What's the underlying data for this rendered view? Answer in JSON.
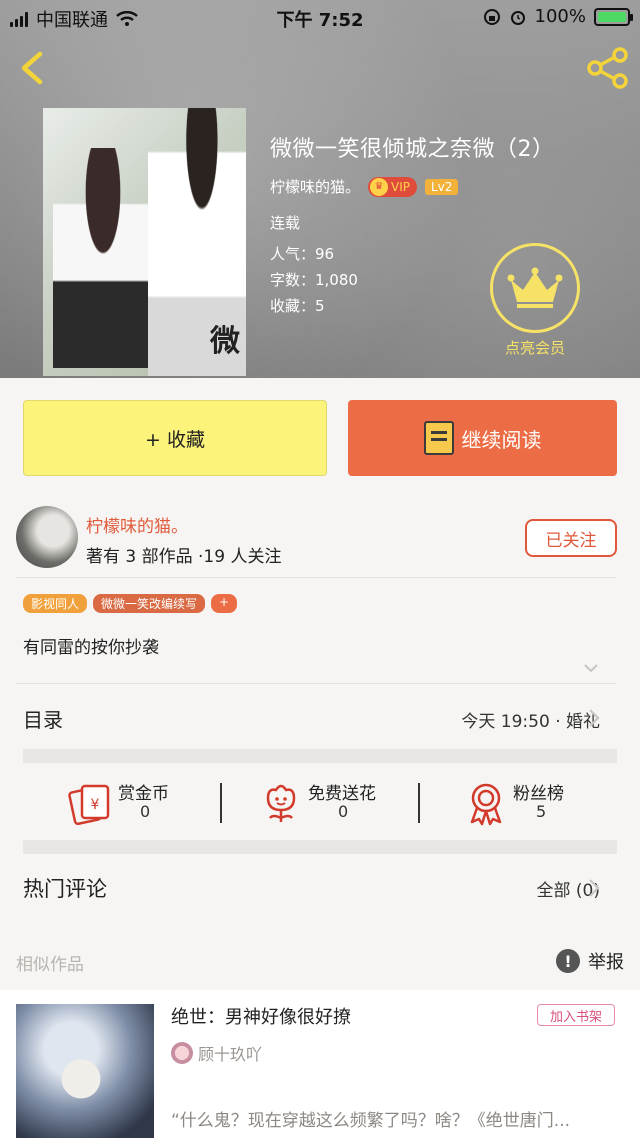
{
  "status_bar": {
    "carrier": "中国联通",
    "time": "下午 7:52",
    "battery": "100%"
  },
  "book": {
    "title": "微微一笑很倾城之奈微（2）",
    "author": "柠檬味的猫。",
    "vip_label": "VIP",
    "level": "Lv2",
    "state": "连载",
    "popularity": "人气：96",
    "word_count": "字数：1,080",
    "favorites": "收藏：5",
    "cover_glyph": "微"
  },
  "membership": {
    "label": "点亮会员"
  },
  "actions": {
    "collect": "+ 收藏",
    "continue_read": "继续阅读"
  },
  "author_panel": {
    "name": "柠檬味的猫。",
    "stats": "著有 3 部作品 ·19 人关注",
    "follow": "已关注"
  },
  "tags": [
    "影视同人",
    "微微一笑改编续写",
    "+"
  ],
  "description": "有同雷的按你抄袭",
  "toc": {
    "label": "目录",
    "latest": "今天 19:50 · 婚礼"
  },
  "stats": [
    {
      "label": "赏金币",
      "value": "0",
      "icon": "bounty-icon"
    },
    {
      "label": "免费送花",
      "value": "0",
      "icon": "flower-icon"
    },
    {
      "label": "粉丝榜",
      "value": "5",
      "icon": "medal-icon"
    }
  ],
  "comments": {
    "label": "热门评论",
    "all": "全部 (0)"
  },
  "similar": {
    "label": "相似作品",
    "report": "举报",
    "item": {
      "title": "绝世：男神好像很好撩",
      "shelf": "加入书架",
      "author": "顾十玖吖",
      "summary": "“什么鬼？现在穿越这么频繁了吗？啥？《绝世唐门..."
    }
  },
  "colors": {
    "accent": "#ec6d45",
    "collect": "#fbf37a",
    "crown": "#f6e266"
  }
}
